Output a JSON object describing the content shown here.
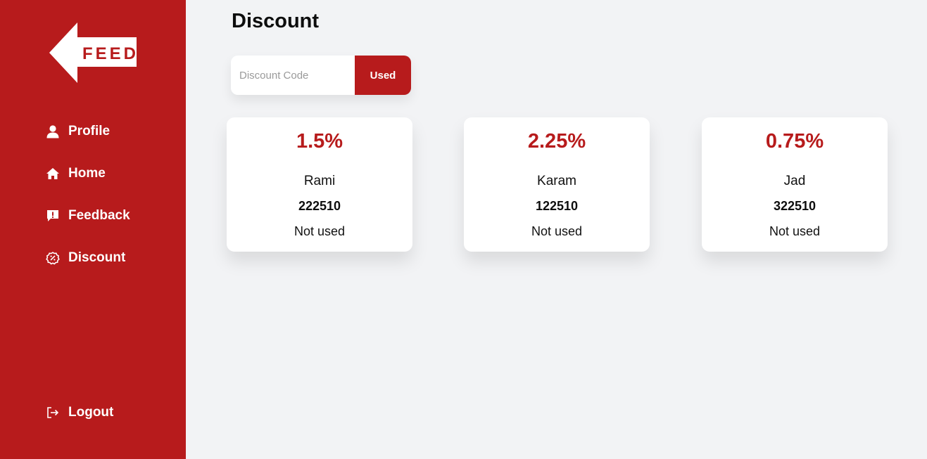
{
  "brand": {
    "logo_text": "FEED",
    "primary_color": "#b71b1c"
  },
  "sidebar": {
    "items": [
      {
        "label": "Profile",
        "icon": "user-icon"
      },
      {
        "label": "Home",
        "icon": "home-icon"
      },
      {
        "label": "Feedback",
        "icon": "feedback-icon"
      },
      {
        "label": "Discount",
        "icon": "discount-icon"
      }
    ],
    "logout": {
      "label": "Logout",
      "icon": "logout-icon"
    }
  },
  "main": {
    "title": "Discount",
    "search": {
      "placeholder": "Discount Code",
      "value": "",
      "button_label": "Used"
    },
    "cards": [
      {
        "percent": "1.5%",
        "name": "Rami",
        "code": "222510",
        "status": "Not used"
      },
      {
        "percent": "2.25%",
        "name": "Karam",
        "code": "122510",
        "status": "Not used"
      },
      {
        "percent": "0.75%",
        "name": "Jad",
        "code": "322510",
        "status": "Not used"
      }
    ]
  }
}
